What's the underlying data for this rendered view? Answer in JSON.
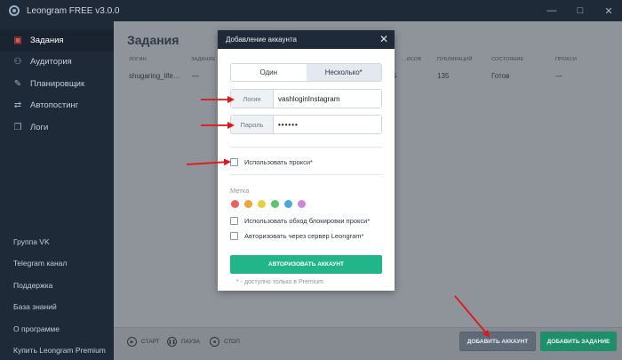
{
  "window": {
    "title": "Leongram FREE v3.0.0",
    "controls": [
      "—",
      "□",
      "✕"
    ]
  },
  "sidebar": {
    "items": [
      {
        "label": "Задания",
        "icon": "tasks-icon",
        "glyph": "▣",
        "active": true
      },
      {
        "label": "Аудитория",
        "icon": "audience-icon",
        "glyph": "⚇",
        "active": false
      },
      {
        "label": "Планировщик",
        "icon": "planner-icon",
        "glyph": "✎",
        "active": false
      },
      {
        "label": "Автопостинг",
        "icon": "autoposting-icon",
        "glyph": "⇄",
        "active": false
      },
      {
        "label": "Логи",
        "icon": "logs-icon",
        "glyph": "❐",
        "active": false
      }
    ],
    "links": [
      "Группа VK",
      "Telegram канал",
      "Поддержка",
      "База знаний",
      "О программе",
      "Купить Leongram Premium"
    ]
  },
  "main": {
    "title": "Задания",
    "table": {
      "headers": [
        "ЛОГИН",
        "ЗАДАНИЕ",
        "…ИСОВ",
        "ПУБЛИКАЦИЙ",
        "СОСТОЯНИЕ",
        "ПРОКСИ"
      ],
      "row": [
        "shugaring_life…",
        "—",
        "5",
        "135",
        "Готов",
        "—"
      ]
    },
    "footer": {
      "start": "СТАРТ",
      "pause": "ПАУЗА",
      "stop": "СТОП",
      "add_account": "ДОБАВИТЬ АККАУНТ",
      "add_task": "ДОБАВИТЬ ЗАДАНИЕ"
    }
  },
  "modal": {
    "title": "Добавление аккаунта",
    "close": "✕",
    "tabs": [
      "Один",
      "Несколько*"
    ],
    "login_label": "Логин",
    "login_value": "vashloginInstagram",
    "password_label": "Пароль",
    "password_value": "••••••",
    "use_proxy": "Использовать прокси*",
    "label_title": "Метка",
    "label_colors": [
      "#e8635c",
      "#f0a23b",
      "#e8cf3d",
      "#5cc46a",
      "#47a9e0",
      "#cf86d9"
    ],
    "bypass_proxy": "Использовать обход блокировки прокси*",
    "auth_server": "Авторизовать через сервер Leongram*",
    "authorize_button": "АВТОРИЗОВАТЬ АККАУНТ",
    "premium_note": "* - доступно только в Premium"
  },
  "colors": {
    "accent": "#22b58a",
    "arrow": "#e0161b",
    "sidebar_bg": "#1e2a38"
  }
}
